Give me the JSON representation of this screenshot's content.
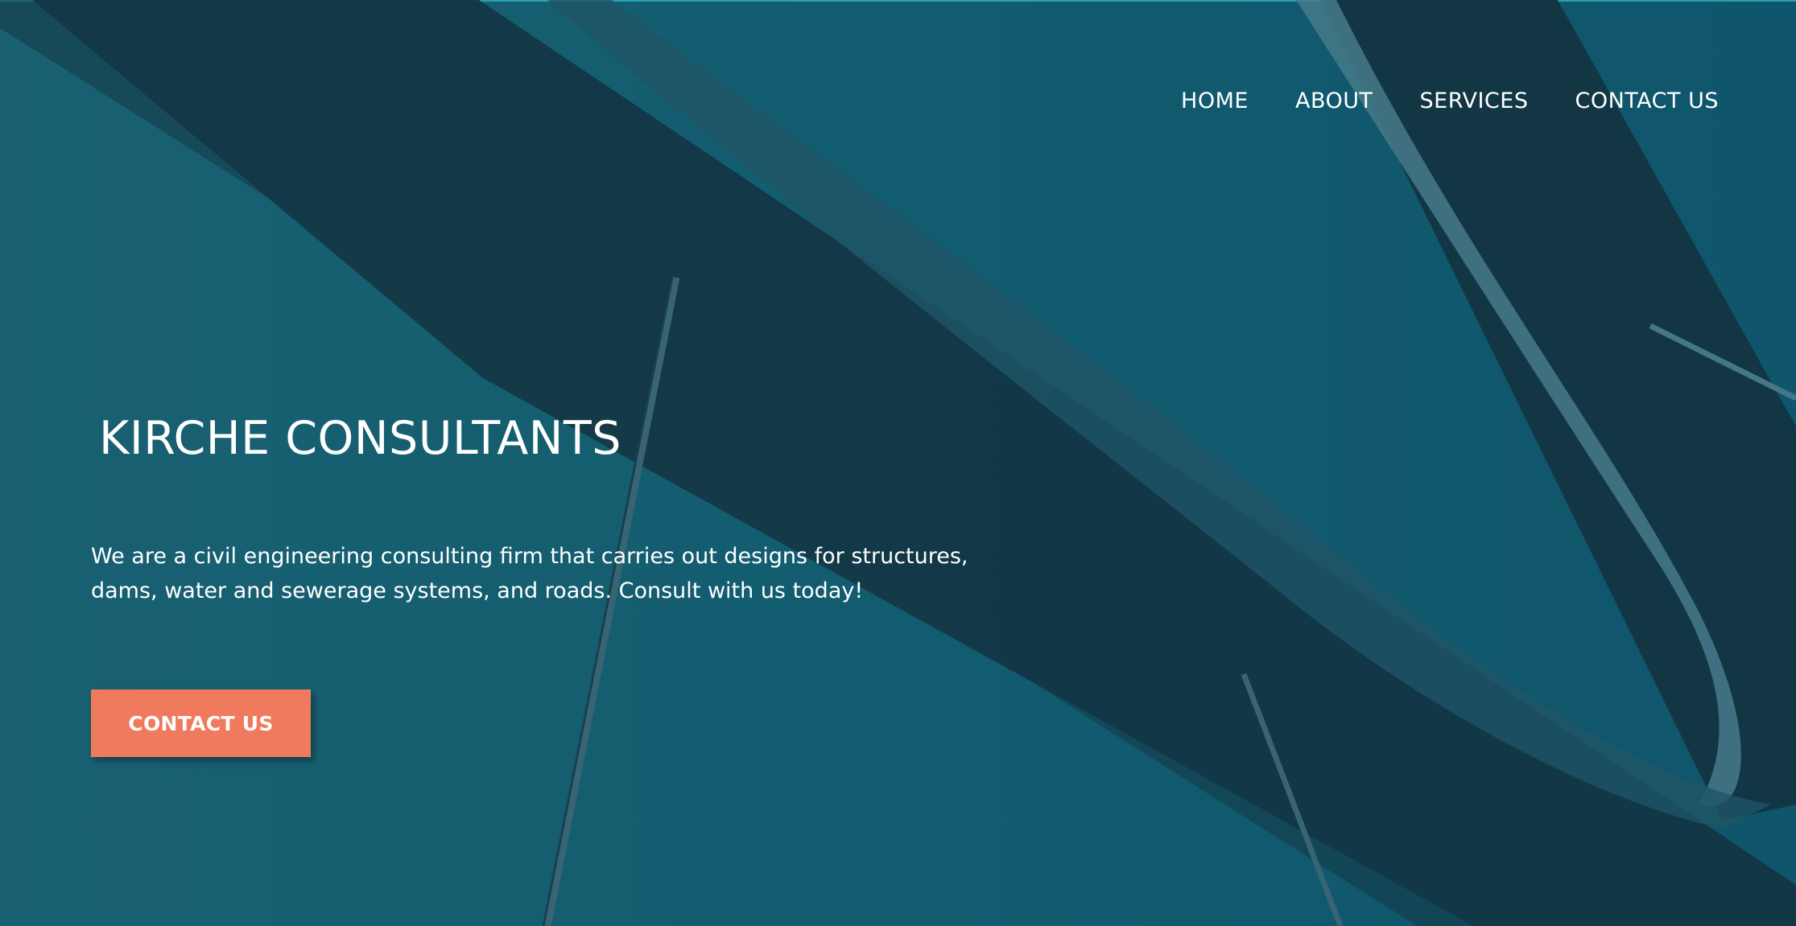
{
  "nav": {
    "items": [
      {
        "label": "HOME"
      },
      {
        "label": "ABOUT"
      },
      {
        "label": "SERVICES"
      },
      {
        "label": "CONTACT US"
      }
    ]
  },
  "hero": {
    "title": "KIRCHE CONSULTANTS",
    "tagline": "We are a civil engineering consulting firm that carries out designs for structures, dams, water and sewerage systems, and roads. Consult with us today!",
    "cta_label": "CONTACT US"
  },
  "colors": {
    "background": "#135d71",
    "dark_structure": "#143644",
    "accent": "#f07a5e",
    "text": "#ffffff"
  },
  "icons": {
    "background_image": "bridge-structure-image"
  }
}
